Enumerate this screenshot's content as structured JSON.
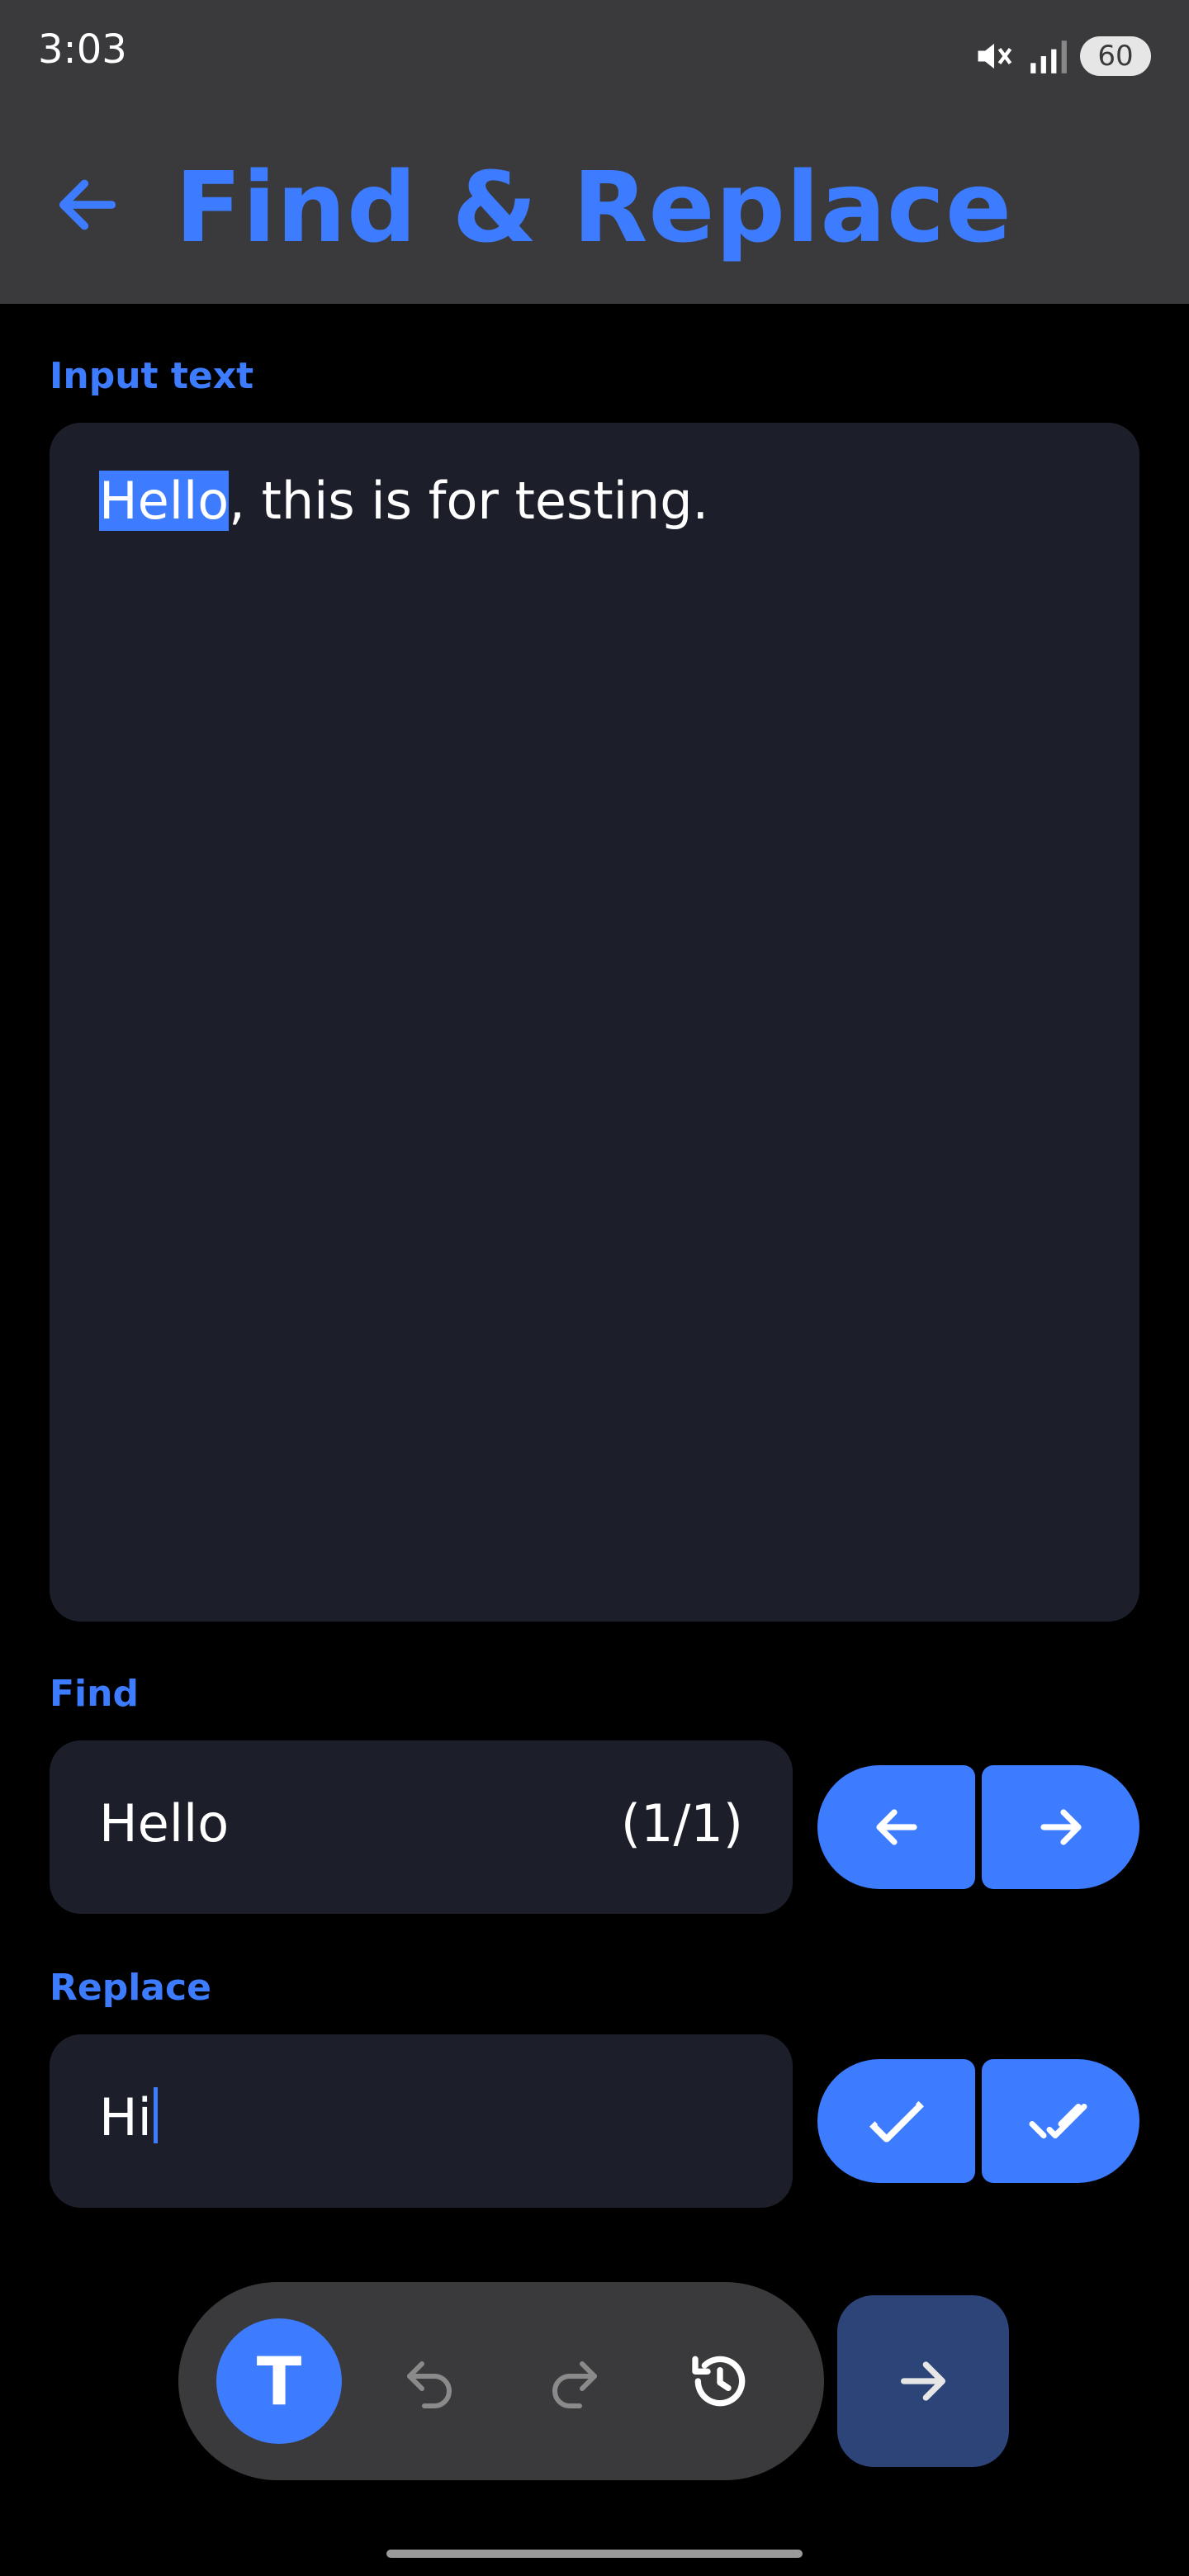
{
  "status_bar": {
    "time": "3:03",
    "battery": "60"
  },
  "app_bar": {
    "title": "Find & Replace"
  },
  "input": {
    "label": "Input text",
    "text_highlight": "Hello",
    "text_rest": ", this is for testing."
  },
  "find": {
    "label": "Find",
    "value": "Hello",
    "count": "(1/1)"
  },
  "replace": {
    "label": "Replace",
    "value": "Hi"
  },
  "toolbar": {
    "text_mode_glyph": "T"
  },
  "icons": {
    "back": "arrow-left-icon",
    "prev_match": "arrow-left-icon",
    "next_match": "arrow-right-icon",
    "replace_one": "check-icon",
    "replace_all": "double-check-icon",
    "undo": "undo-icon",
    "redo": "redo-icon",
    "history": "history-icon",
    "next": "arrow-right-icon"
  },
  "colors": {
    "accent": "#3d7cff",
    "bar_bg": "#3a3a3c",
    "field_bg": "#1c1f2a",
    "next_btn": "#2d4478"
  }
}
